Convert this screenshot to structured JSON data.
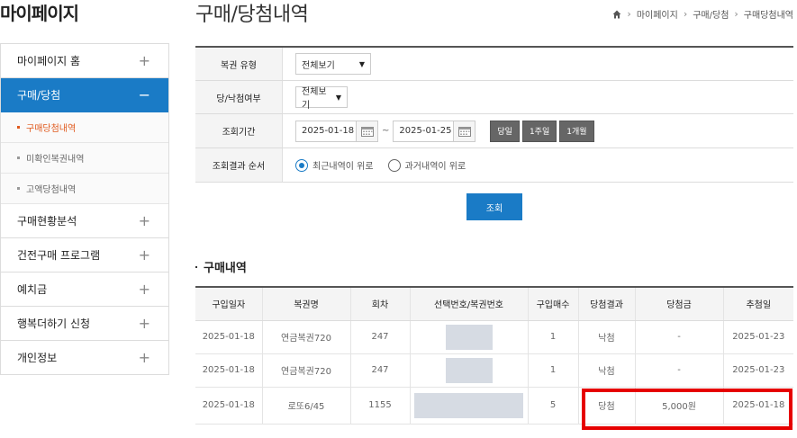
{
  "sidebar": {
    "title": "마이페이지",
    "menu": [
      {
        "label": "마이페이지 홈",
        "icon": "+"
      },
      {
        "label": "구매/당첨",
        "icon": "−"
      },
      {
        "label": "구매현황분석",
        "icon": "+"
      },
      {
        "label": "건전구매 프로그램",
        "icon": "+"
      },
      {
        "label": "예치금",
        "icon": "+"
      },
      {
        "label": "행복더하기 신청",
        "icon": "+"
      },
      {
        "label": "개인정보",
        "icon": "+"
      }
    ],
    "submenu": [
      "구매당첨내역",
      "미확인복권내역",
      "고액당첨내역"
    ]
  },
  "header": {
    "title": "구매/당첨내역",
    "breadcrumb": [
      "마이페이지",
      "구매/당첨",
      "구매당첨내역"
    ]
  },
  "search": {
    "rows": {
      "type_label": "복권 유형",
      "type_value": "전체보기",
      "win_label": "당/낙첨여부",
      "win_value": "전체보기",
      "period_label": "조회기간",
      "date_from": "2025-01-18",
      "tilde": "~",
      "date_to": "2025-01-25",
      "periods": [
        "당일",
        "1주일",
        "1개월"
      ],
      "order_label": "조회결과 순서",
      "order_options": [
        "최근내역이 위로",
        "과거내역이 위로"
      ]
    },
    "button": "조회"
  },
  "results": {
    "title": "구매내역",
    "headers": [
      "구입일자",
      "복권명",
      "회차",
      "선택번호/복권번호",
      "구입매수",
      "당첨결과",
      "당첨금",
      "추첨일"
    ],
    "rows": [
      [
        "2025-01-18",
        "연금복권720",
        "247",
        "",
        "1",
        "낙첨",
        "-",
        "2025-01-23"
      ],
      [
        "2025-01-18",
        "연금복권720",
        "247",
        "",
        "1",
        "낙첨",
        "-",
        "2025-01-23"
      ],
      [
        "2025-01-18",
        "로또6/45",
        "1155",
        "",
        "5",
        "당첨",
        "5,000원",
        "2025-01-18"
      ]
    ]
  },
  "colors": {
    "accent": "#1a7bc6",
    "highlight": "#e60000",
    "active_sub": "#e05a1e"
  }
}
